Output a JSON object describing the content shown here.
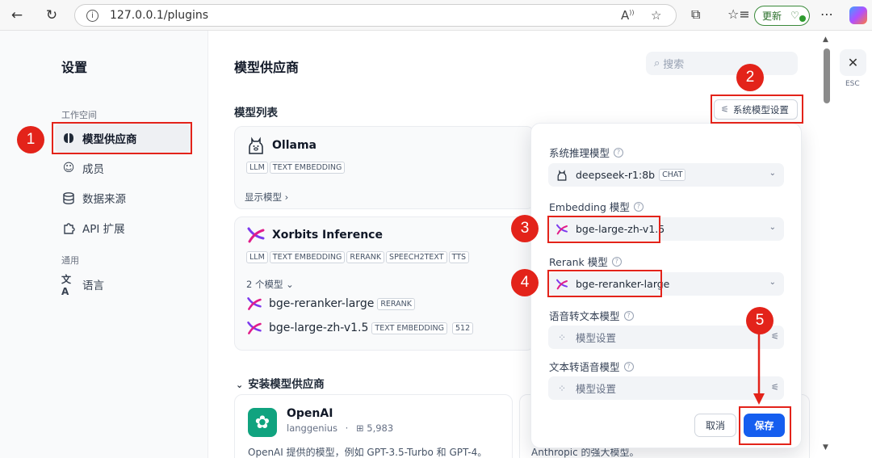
{
  "browser": {
    "url": "127.0.0.1/plugins",
    "update_label": "更新"
  },
  "sidebar": {
    "title": "设置",
    "workspace_section": "工作空间",
    "general_section": "通用",
    "items": [
      {
        "label": "模型供应商",
        "icon": "brain-icon",
        "active": true
      },
      {
        "label": "成员",
        "icon": "members-icon"
      },
      {
        "label": "数据来源",
        "icon": "database-icon"
      },
      {
        "label": "API 扩展",
        "icon": "puzzle-icon"
      },
      {
        "label": "语言",
        "icon": "translate-icon"
      }
    ]
  },
  "main": {
    "title": "模型供应商",
    "search_placeholder": "搜索",
    "model_list_title": "模型列表",
    "system_model_settings_label": "系统模型设置",
    "providers": [
      {
        "name": "Ollama",
        "tags": [
          "LLM",
          "TEXT EMBEDDING"
        ],
        "link": "显示模型 ›"
      },
      {
        "name": "Xorbits Inference",
        "tags": [
          "LLM",
          "TEXT EMBEDDING",
          "RERANK",
          "SPEECH2TEXT",
          "TTS"
        ],
        "link": "2 个模型 ⌄",
        "models": [
          {
            "name": "bge-reranker-large",
            "tags": [
              "RERANK"
            ]
          },
          {
            "name": "bge-large-zh-v1.5",
            "tags": [
              "TEXT EMBEDDING",
              "512"
            ]
          }
        ]
      }
    ],
    "install_title": "安装模型供应商",
    "install_cards": [
      {
        "name": "OpenAI",
        "author": "langgenius",
        "installs": "5,983",
        "desc": "OpenAI 提供的模型，例如 GPT-3.5-Turbo 和 GPT-4。"
      },
      {
        "desc": "Anthropic 的强大模型。"
      }
    ]
  },
  "popover": {
    "fields": [
      {
        "label": "系统推理模型",
        "value": "deepseek-r1:8b",
        "badge": "CHAT",
        "icon": "llama-icon"
      },
      {
        "label": "Embedding 模型",
        "value": "bge-large-zh-v1.5",
        "icon": "xorbits-icon"
      },
      {
        "label": "Rerank 模型",
        "value": "bge-reranker-large",
        "icon": "xorbits-icon"
      },
      {
        "label": "语音转文本模型",
        "placeholder": "模型设置"
      },
      {
        "label": "文本转语音模型",
        "placeholder": "模型设置"
      }
    ],
    "cancel_label": "取消",
    "save_label": "保存"
  },
  "close": {
    "label": "ESC"
  },
  "annotations": [
    "1",
    "2",
    "3",
    "4",
    "5"
  ],
  "colors": {
    "accent": "#155eef",
    "annotation_red": "#e3231a",
    "openai_green": "#10a37f"
  }
}
